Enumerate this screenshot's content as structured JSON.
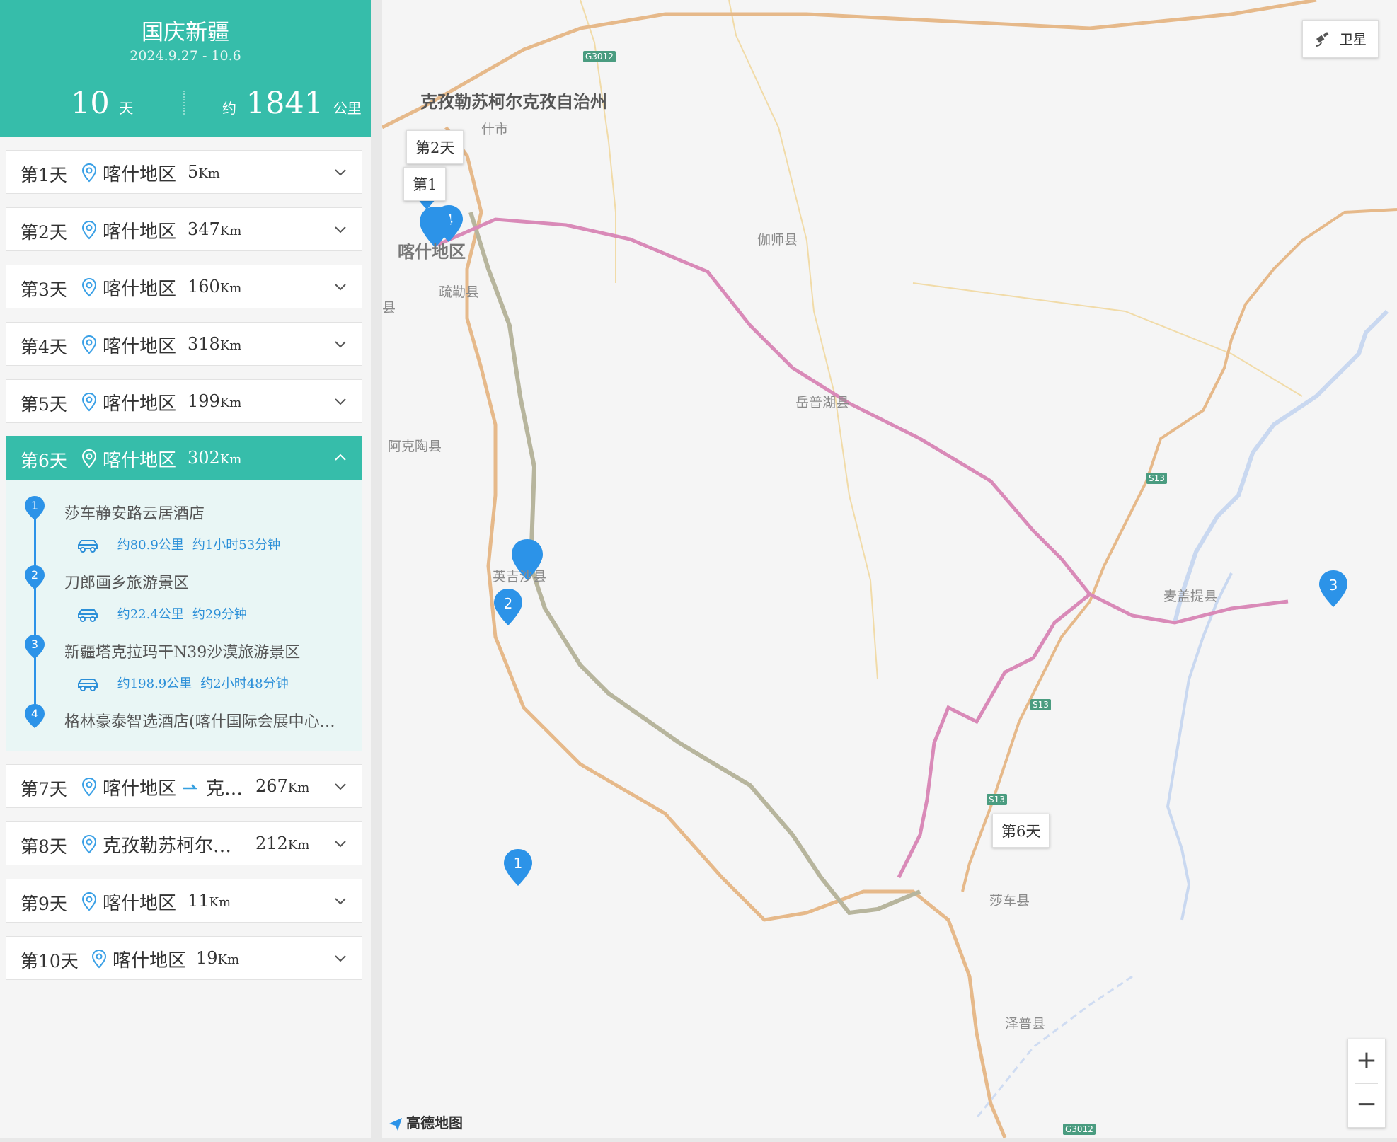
{
  "trip": {
    "title": "国庆新疆",
    "dates": "2024.9.27 - 10.6",
    "days_num": "10",
    "days_unit": "天",
    "dist_prefix": "约",
    "dist_num": "1841",
    "dist_unit": "公里"
  },
  "days": [
    {
      "label": "第1天",
      "location": "喀什地区",
      "km": "5",
      "unit": "Km"
    },
    {
      "label": "第2天",
      "location": "喀什地区",
      "km": "347",
      "unit": "Km"
    },
    {
      "label": "第3天",
      "location": "喀什地区",
      "km": "160",
      "unit": "Km"
    },
    {
      "label": "第4天",
      "location": "喀什地区",
      "km": "318",
      "unit": "Km"
    },
    {
      "label": "第5天",
      "location": "喀什地区",
      "km": "199",
      "unit": "Km"
    },
    {
      "label": "第6天",
      "location": "喀什地区",
      "km": "302",
      "unit": "Km"
    },
    {
      "label": "第7天",
      "location": "喀什地区",
      "location2": "克…",
      "km": "267",
      "unit": "Km"
    },
    {
      "label": "第8天",
      "location": "克孜勒苏柯尔…",
      "km": "212",
      "unit": "Km"
    },
    {
      "label": "第9天",
      "location": "喀什地区",
      "km": "11",
      "unit": "Km"
    },
    {
      "label": "第10天",
      "location": "喀什地区",
      "km": "19",
      "unit": "Km"
    }
  ],
  "day6_stops": [
    {
      "num": "1",
      "name": "莎车静安路云居酒店"
    },
    {
      "num": "2",
      "name": "刀郎画乡旅游景区"
    },
    {
      "num": "3",
      "name": "新疆塔克拉玛干N39沙漠旅游景区"
    },
    {
      "num": "4",
      "name": "格林豪泰智选酒店(喀什国际会展中心…"
    }
  ],
  "day6_segments": [
    {
      "distance": "约80.9公里",
      "duration": "约1小时53分钟"
    },
    {
      "distance": "约22.4公里",
      "duration": "约29分钟"
    },
    {
      "distance": "约198.9公里",
      "duration": "约2小时48分钟"
    }
  ],
  "map": {
    "labels": {
      "prefecture": "克孜勒苏柯尔克孜自治州",
      "kashgar_city": "什市",
      "kashgar": "喀什地区",
      "shule": "疏勒县",
      "jiashi": "伽师县",
      "yuepuhu": "岳普湖县",
      "aketao": "阿克陶县",
      "yingjisha": "英吉沙县",
      "maigaiti": "麦盖提县",
      "shache": "莎车县",
      "zepu": "泽普县",
      "xian": "县"
    },
    "roads": {
      "g3012": "G3012",
      "s13": "S13"
    },
    "tooltips": {
      "day2": "第2天",
      "day1": "第1",
      "day6": "第6天"
    },
    "markers": {
      "m1": "1",
      "m2": "2",
      "m3": "3",
      "m4": "4"
    },
    "satellite": "卫星",
    "zoom_in": "+",
    "zoom_out": "−",
    "logo": "高德地图"
  },
  "colors": {
    "accent": "#36bdaa",
    "route": "#d98ab8",
    "marker": "#2c93e8"
  }
}
